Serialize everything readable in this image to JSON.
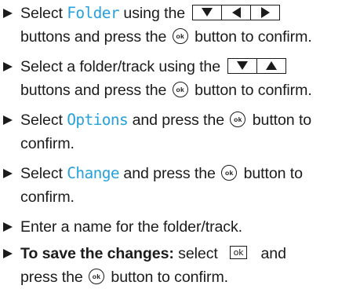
{
  "steps": [
    {
      "select": "Select",
      "folder_menu": "Folder",
      "using_the": "using the",
      "buttons_press": "buttons and press the",
      "ok_icon": "ok",
      "button_to_confirm": "button to confirm."
    },
    {
      "text": "Select a folder/track using the",
      "buttons_press": "buttons and press the",
      "ok_icon": "ok",
      "button_to_confirm": "button to confirm."
    },
    {
      "select": "Select",
      "options_menu": "Options",
      "and_press": "and press the",
      "ok_icon": "ok",
      "button_to": "button to",
      "confirm": "confirm."
    },
    {
      "select": "Select",
      "change_menu": "Change",
      "and_press": "and press the",
      "ok_icon": "ok",
      "button_to": "button to",
      "confirm": "confirm."
    },
    {
      "text": "Enter a name for the folder/track."
    },
    {
      "bold_lead": "To save the changes:",
      "select": "select",
      "ok_key": "ok",
      "and": "and",
      "press_the": "press the",
      "ok_icon": "ok",
      "button_to_confirm": "button to confirm."
    }
  ],
  "icons": {
    "bullet": "triangle-right-icon",
    "down": "arrow-down-key-icon",
    "up": "arrow-up-key-icon",
    "left": "arrow-left-key-icon",
    "right": "arrow-right-key-icon",
    "ok_button": "ok-button-icon"
  },
  "colors": {
    "menu_text": "#27a0dc",
    "body_text": "#1b1b1b"
  }
}
